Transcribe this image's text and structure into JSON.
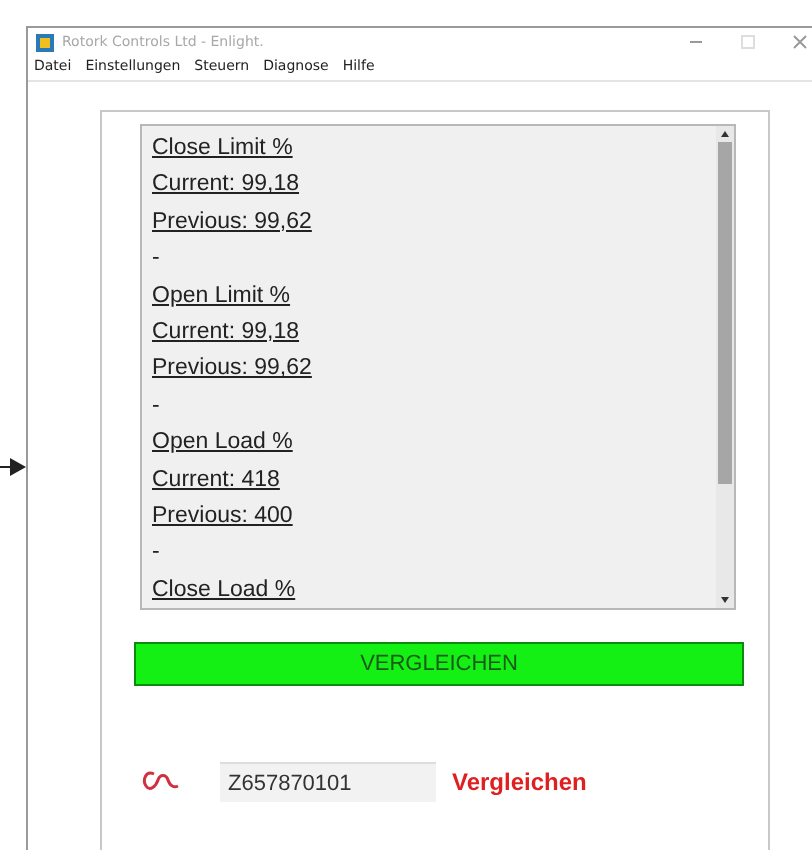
{
  "window": {
    "title": "Rotork Controls Ltd - Enlight."
  },
  "menu": [
    {
      "label": "Datei"
    },
    {
      "label": "Einstellungen"
    },
    {
      "label": "Steuern"
    },
    {
      "label": "Diagnose"
    },
    {
      "label": "Hilfe"
    }
  ],
  "list": [
    {
      "title": "Close Limit %",
      "current": "Current: 99,18",
      "previous": "Previous: 99,62"
    },
    {
      "separator": "-",
      "title": "Open Limit %",
      "current": "Current: 99,18",
      "previous": "Previous: 99,62"
    },
    {
      "separator": "-",
      "title": "Open Load %",
      "current": "Current: 418",
      "previous": "Previous: 400"
    },
    {
      "separator": "-",
      "title": "Close Load %"
    }
  ],
  "compare_button": {
    "label": "VERGLEICHEN"
  },
  "serial_field": {
    "value": "Z657870101"
  },
  "status": {
    "label": "Vergleichen"
  }
}
